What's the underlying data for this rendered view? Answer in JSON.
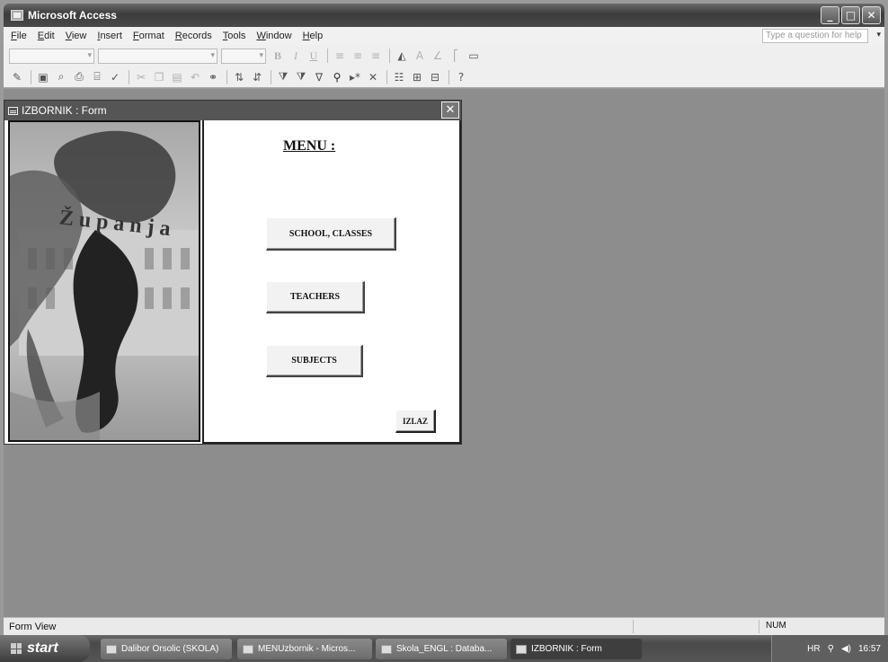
{
  "window": {
    "title": "Microsoft Access",
    "minimize_glyph": "_",
    "maximize_glyph": "□",
    "close_glyph": "✕"
  },
  "menubar": {
    "items": [
      "File",
      "Edit",
      "View",
      "Insert",
      "Format",
      "Records",
      "Tools",
      "Window",
      "Help"
    ],
    "help_placeholder": "Type a question for help"
  },
  "toolbar1": {
    "icons": [
      "bold-icon",
      "italic-icon",
      "underline-icon",
      "align-left-icon",
      "align-center-icon",
      "align-right-icon",
      "fill-color-icon",
      "font-color-icon",
      "line-color-icon",
      "line-width-icon",
      "special-effect-icon"
    ]
  },
  "toolbar2": {
    "icons": [
      "view-icon",
      "save-icon",
      "search-icon",
      "print-icon",
      "print-preview-icon",
      "spelling-icon",
      "cut-icon",
      "copy-icon",
      "paste-icon",
      "undo-icon",
      "hyperlink-icon",
      "sort-asc-icon",
      "sort-desc-icon",
      "filter-icon",
      "filter-form-icon",
      "apply-filter-icon",
      "find-icon",
      "new-record-icon",
      "delete-record-icon",
      "properties-icon",
      "database-window-icon",
      "new-object-icon",
      "help-icon"
    ]
  },
  "form": {
    "title": "IZBORNIK : Form",
    "menu_title": "MENU :",
    "buttons": {
      "school": "SCHOOL, CLASSES",
      "teachers": "TEACHERS",
      "subjects": "SUBJECTS",
      "izlaz": "IZLAZ"
    },
    "logo_text": "Županja"
  },
  "statusbar": {
    "left": "Form View",
    "num": "NUM"
  },
  "taskbar": {
    "start": "start",
    "tasks": [
      "Dalibor Orsolic (SKOLA)",
      "MENUzbornik - Micros...",
      "Skola_ENGL : Databa...",
      "IZBORNIK : Form"
    ],
    "tray_lang": "HR",
    "clock": "16:57"
  }
}
